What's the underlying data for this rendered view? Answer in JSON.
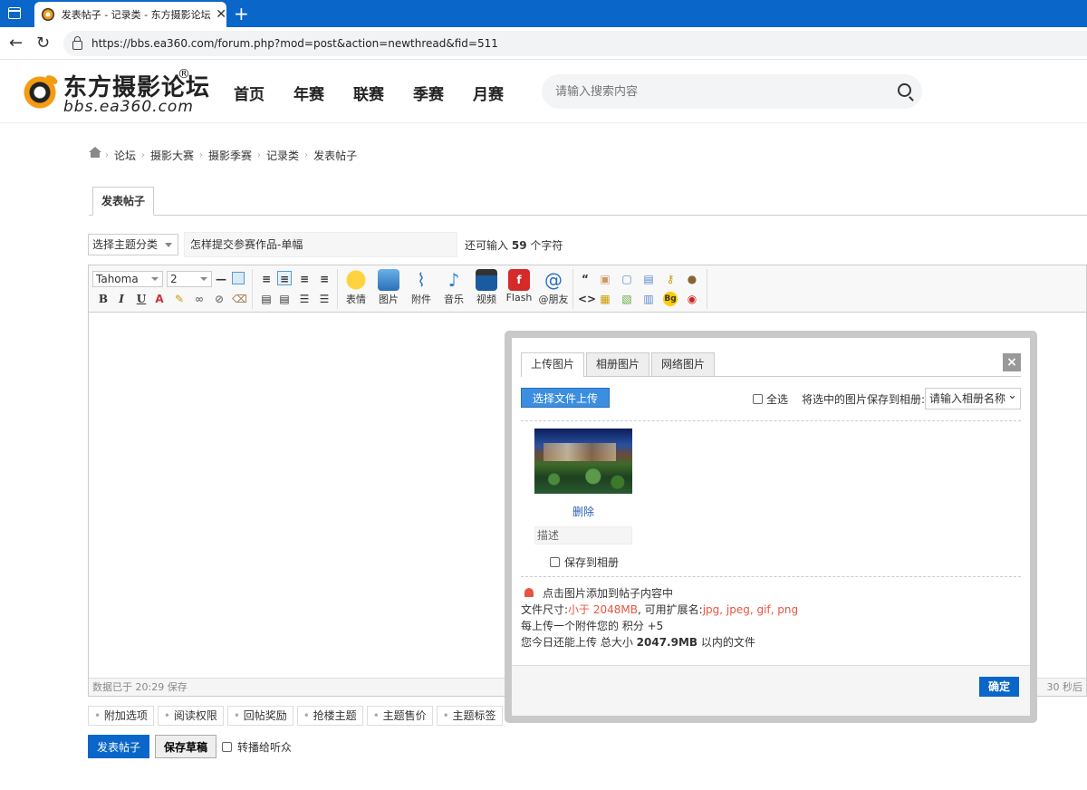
{
  "browser": {
    "tab_title": "发表帖子 - 记录类 - 东方摄影论坛",
    "url": "https://bbs.ea360.com/forum.php?mod=post&action=newthread&fid=511"
  },
  "site": {
    "logo_text": "东方摄影论坛",
    "logo_reg": "®",
    "logo_sub": "bbs.ea360.com",
    "nav": [
      "首页",
      "年赛",
      "联赛",
      "季赛",
      "月赛"
    ],
    "search_placeholder": "请输入搜索内容"
  },
  "breadcrumb": [
    "论坛",
    "摄影大赛",
    "摄影季赛",
    "记录类",
    "发表帖子"
  ],
  "post_tab": "发表帖子",
  "subject": {
    "type_select": "选择主题分类",
    "title_value": "怎样提交参赛作品-单幅",
    "remain_prefix": "还可输入",
    "remain_count": "59",
    "remain_suffix": "个字符"
  },
  "editor": {
    "font": "Tahoma",
    "size": "2",
    "buttons": [
      "表情",
      "图片",
      "附件",
      "音乐",
      "视频",
      "Flash",
      "@朋友"
    ],
    "status_left": "数据已于 20:29 保存",
    "status_right": "30 秒后"
  },
  "options": [
    "附加选项",
    "阅读权限",
    "回帖奖励",
    "抢楼主题",
    "主题售价",
    "主题标签"
  ],
  "actions": {
    "submit": "发表帖子",
    "draft": "保存草稿",
    "broadcast": "转播给听众"
  },
  "modal": {
    "tabs": [
      "上传图片",
      "相册图片",
      "网络图片"
    ],
    "upload_button": "选择文件上传",
    "select_all": "全选",
    "save_to_album_label": "将选中的图片保存到相册:",
    "album_select": "请输入相册名称",
    "delete": "删除",
    "desc_placeholder": "描述",
    "save_album_check": "保存到相册",
    "info_tip": "点击图片添加到帖子内容中",
    "size_prefix": "文件尺寸:",
    "size_value": "小于 2048MB",
    "ext_prefix": ", 可用扩展名:",
    "ext_value": "jpg, jpeg, gif, png",
    "credit_text": "每上传一个附件您的 积分 +5",
    "today_prefix": "您今日还能上传 总大小",
    "today_value": "2047.9MB",
    "today_suffix": "以内的文件",
    "confirm": "确定"
  }
}
